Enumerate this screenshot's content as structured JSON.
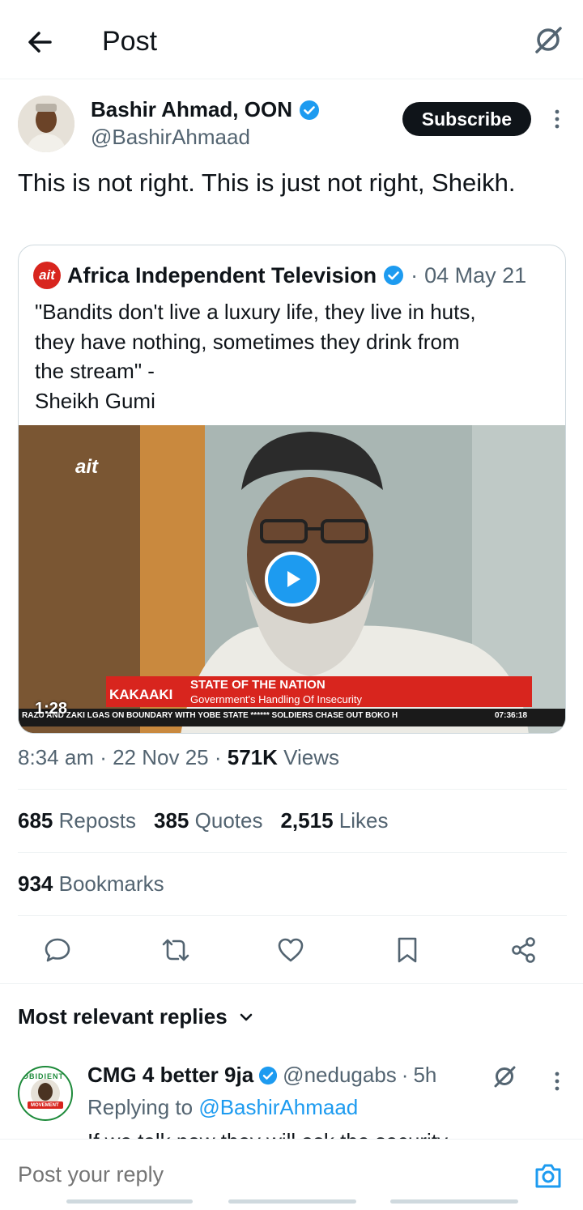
{
  "header": {
    "title": "Post"
  },
  "author": {
    "name": "Bashir Ahmad, OON",
    "handle": "@BashirAhmaad",
    "subscribe_label": "Subscribe"
  },
  "tweet": {
    "text": "This is not right. This is just not right, Sheikh."
  },
  "quote": {
    "logo_text": "ait",
    "name": "Africa Independent Television",
    "separator": "·",
    "date": "04 May 21",
    "text_lines": [
      "\"Bandits don't live a luxury life, they live in huts,",
      "they have nothing, sometimes they drink from",
      "the stream\" -",
      "Sheikh Gumi"
    ],
    "video": {
      "duration": "1:28",
      "channel_bug": "ait",
      "program": "KAKAAKI",
      "banner_title": "STATE OF THE NATION",
      "banner_subtitle": "Government's Handling Of Insecurity",
      "ticker": "RAZU AND ZAKI LGAS ON BOUNDARY WITH YOBE STATE ****** SOLDIERS CHASE OUT BOKO H",
      "clock": "07:36:18"
    }
  },
  "meta": {
    "time": "8:34 am",
    "sep": "·",
    "date": "22 Nov 25",
    "views_count": "571K",
    "views_label": "Views"
  },
  "stats": {
    "reposts_count": "685",
    "reposts_label": "Reposts",
    "quotes_count": "385",
    "quotes_label": "Quotes",
    "likes_count": "2,515",
    "likes_label": "Likes",
    "bookmarks_count": "934",
    "bookmarks_label": "Bookmarks"
  },
  "replies": {
    "header": "Most relevant replies",
    "items": [
      {
        "name": "CMG 4 better 9ja",
        "handle": "@nedugabs",
        "sep": "·",
        "time": "5h",
        "replying_prefix": "Replying to",
        "replying_to": "@BashirAhmaad",
        "text": "If we talk now they will ask the security",
        "avatar_text_top": "OBIDIENT",
        "avatar_text_bottom": "MOVEMENT"
      }
    ]
  },
  "composer": {
    "placeholder": "Post your reply"
  },
  "colors": {
    "accent": "#1d9bf0",
    "text": "#0f1419",
    "muted": "#536471",
    "ait_red": "#d8251e"
  },
  "icons": {
    "back": "arrow-left-icon",
    "grok": "grok-icon",
    "verified": "verified-badge-icon",
    "more": "more-vertical-icon",
    "play": "play-icon",
    "reply": "reply-icon",
    "repost": "repost-icon",
    "like": "heart-icon",
    "bookmark": "bookmark-icon",
    "share": "share-icon",
    "chevron": "chevron-down-icon",
    "camera": "camera-icon"
  }
}
